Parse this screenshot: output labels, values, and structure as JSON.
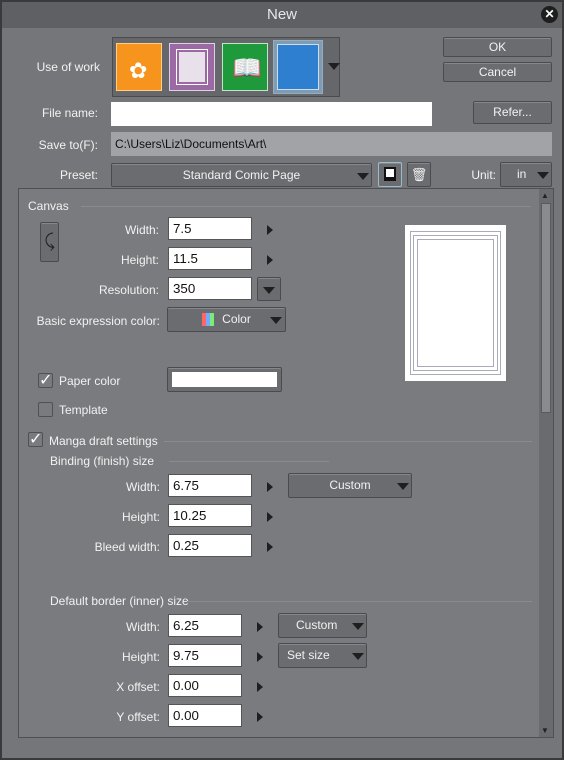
{
  "window": {
    "title": "New"
  },
  "header": {
    "use_of_work_label": "Use of work",
    "work_types": [
      {
        "name": "illustration",
        "color": "#f7941d",
        "selected": false
      },
      {
        "name": "webtoon",
        "color": "#9b6aa5",
        "selected": false
      },
      {
        "name": "comic",
        "color": "#1e9a3c",
        "selected": false
      },
      {
        "name": "animation",
        "color": "#2f7fd0",
        "selected": true
      }
    ],
    "ok_label": "OK",
    "cancel_label": "Cancel",
    "file_name_label": "File name:",
    "file_name_value": "",
    "refer_label": "Refer...",
    "save_to_label": "Save to(F):",
    "save_to_value": "C:\\Users\\Liz\\Documents\\Art\\",
    "preset_label": "Preset:",
    "preset_value": "Standard Comic Page",
    "unit_label": "Unit:",
    "unit_value": "in"
  },
  "canvas": {
    "section": "Canvas",
    "width_label": "Width:",
    "width_value": "7.5",
    "height_label": "Height:",
    "height_value": "11.5",
    "resolution_label": "Resolution:",
    "resolution_value": "350",
    "color_label": "Basic expression color:",
    "color_value": "Color",
    "paper_color_label": "Paper color",
    "paper_color_checked": true,
    "paper_color": "#ffffff",
    "template_label": "Template",
    "template_checked": false
  },
  "manga": {
    "section": "Manga draft settings",
    "checked": true,
    "binding_section": "Binding (finish) size",
    "b_width_label": "Width:",
    "b_width_value": "6.75",
    "b_preset": "Custom",
    "b_height_label": "Height:",
    "b_height_value": "10.25",
    "bleed_label": "Bleed width:",
    "bleed_value": "0.25",
    "border_section": "Default border (inner) size",
    "d_width_label": "Width:",
    "d_width_value": "6.25",
    "d_preset": "Custom",
    "d_height_label": "Height:",
    "d_height_value": "9.75",
    "set_size_label": "Set size",
    "x_label": "X offset:",
    "x_value": "0.00",
    "y_label": "Y offset:",
    "y_value": "0.00"
  }
}
